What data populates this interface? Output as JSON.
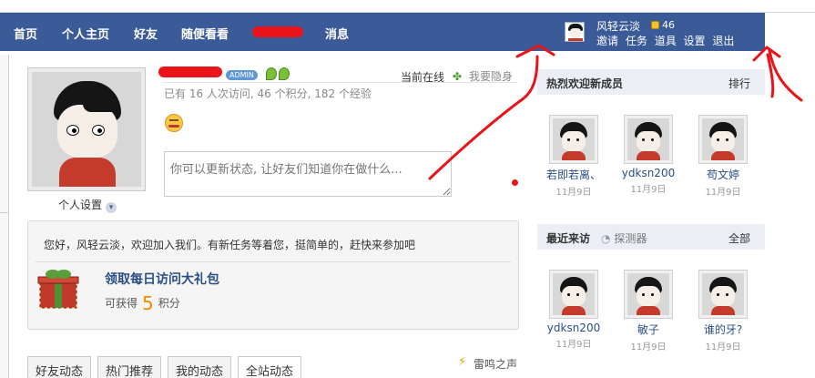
{
  "nav": {
    "items": [
      "首页",
      "个人主页",
      "好友",
      "随便看看",
      "消息"
    ]
  },
  "user": {
    "name": "风轻云淡",
    "coins": "46",
    "links": [
      "邀请",
      "任务",
      "道具",
      "设置",
      "退出"
    ]
  },
  "profile": {
    "badge": "ADMIN",
    "online_status": "当前在线",
    "invisible_label": "我要隐身",
    "stats_text": "已有 16 人次访问, 46 个积分, 182 个经验",
    "status_placeholder": "你可以更新状态, 让好友们知道你在做什么...",
    "settings_label": "个人设置"
  },
  "notice": {
    "welcome": "您好，风轻云淡，欢迎加入我们。有新任务等着您，挺简单的，赶快来参加吧",
    "gift_title": "领取每日访问大礼包",
    "earn_prefix": "可获得",
    "earn_points": "5",
    "earn_suffix": "积分"
  },
  "feed_tabs": [
    "好友动态",
    "热门推荐",
    "我的动态",
    "全站动态"
  ],
  "thunder_label": "雷鸣之声",
  "new_members": {
    "title": "热烈欢迎新成员",
    "link": "排行",
    "members": [
      {
        "name": "若即若离、",
        "date": "11月9日"
      },
      {
        "name": "ydksn200",
        "date": "11月9日"
      },
      {
        "name": "苟文婷",
        "date": "11月9日"
      }
    ]
  },
  "recent_visitors": {
    "title": "最近来访",
    "probe": "探测器",
    "link": "全部",
    "members": [
      {
        "name": "ydksn200",
        "date": "11月9日"
      },
      {
        "name": "敏子",
        "date": "11月9日"
      },
      {
        "name": "谁的牙?",
        "date": "11月9日"
      }
    ]
  },
  "colors": {
    "nav_bg": "#3b5a98",
    "link": "#2a4f86",
    "points": "#f28c00",
    "annotation_red": "#e8141a"
  }
}
